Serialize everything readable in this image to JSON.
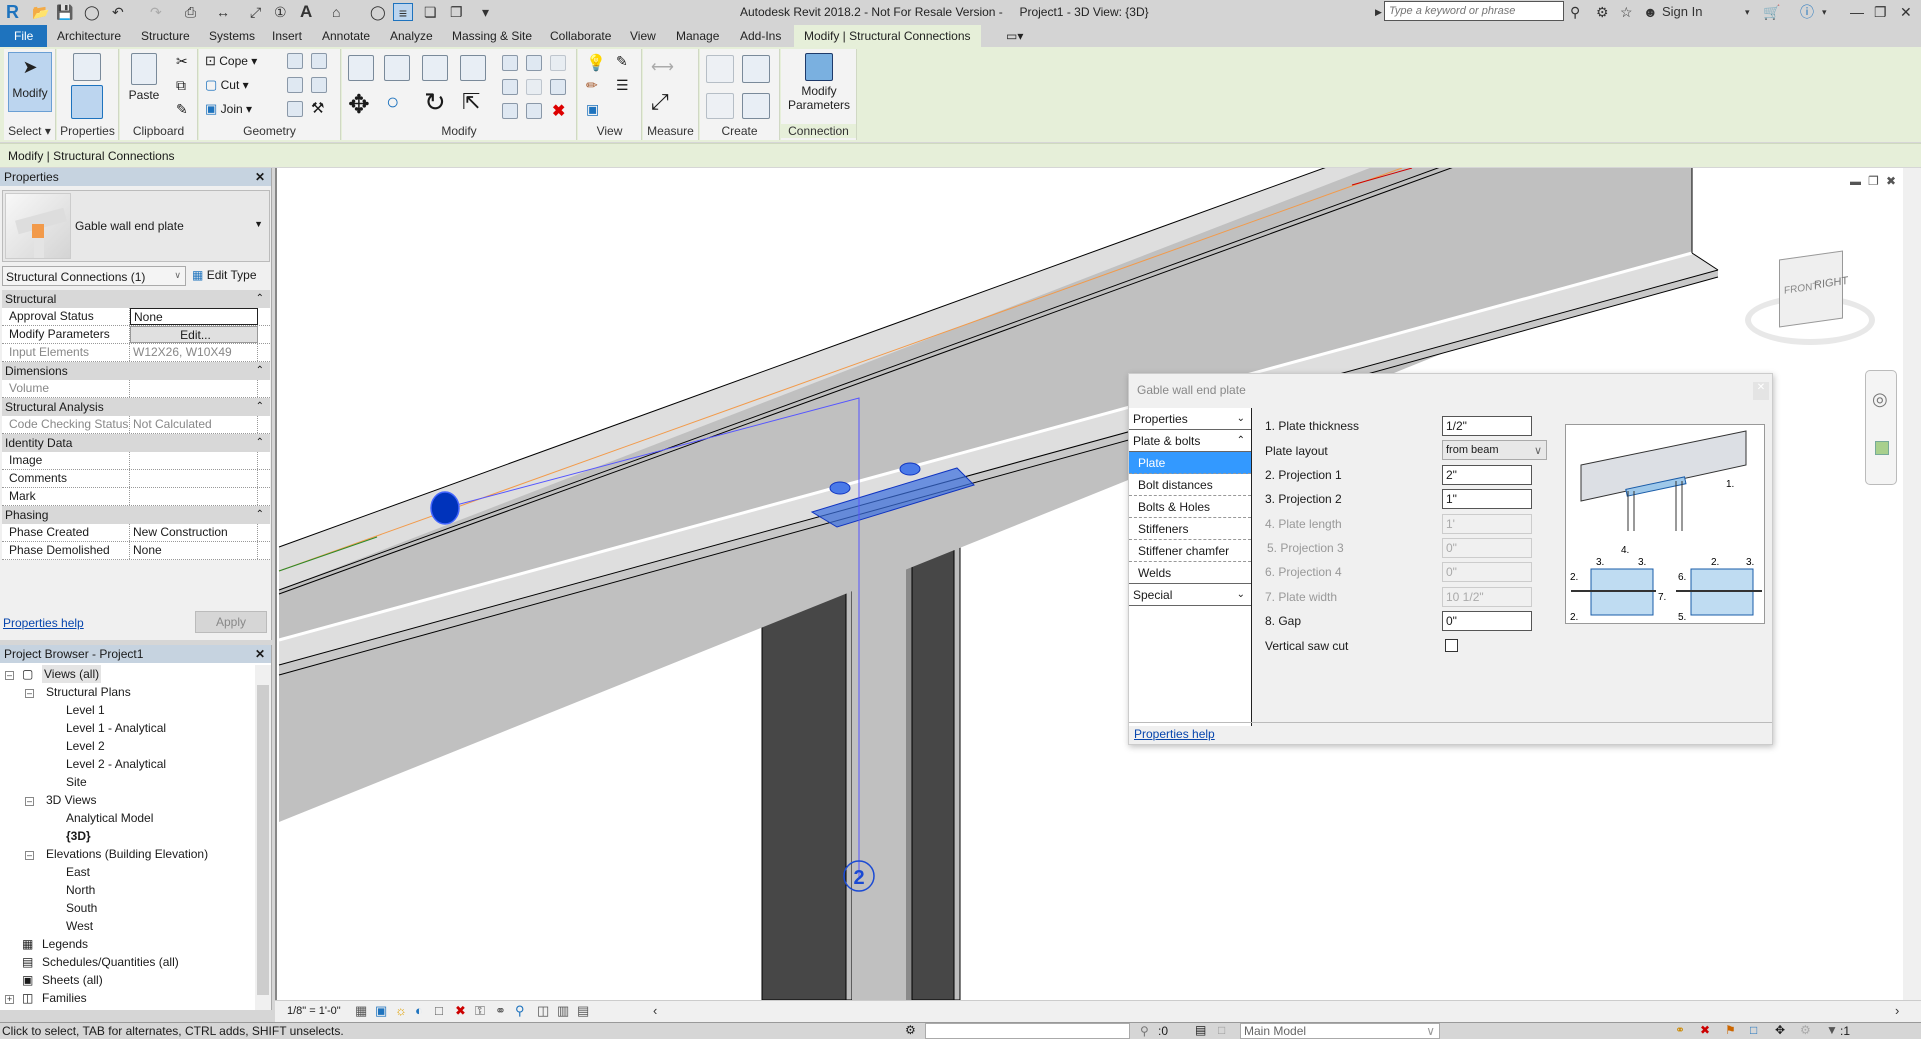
{
  "app": {
    "title": "Autodesk Revit 2018.2 - Not For Resale Version -     Project1 - 3D View: {3D}",
    "search_placeholder": "Type a keyword or phrase",
    "sign_in": "Sign In"
  },
  "tabs": [
    "File",
    "Architecture",
    "Structure",
    "Systems",
    "Insert",
    "Annotate",
    "Analyze",
    "Massing & Site",
    "Collaborate",
    "View",
    "Manage",
    "Add-Ins",
    "Modify | Structural Connections"
  ],
  "ribbon": {
    "panels": {
      "select": "Select",
      "properties": "Properties",
      "clipboard": "Clipboard",
      "geometry": "Geometry",
      "modify": "Modify",
      "view": "View",
      "measure": "Measure",
      "create": "Create",
      "connection": "Connection"
    },
    "modify_button": "Modify",
    "paste_button": "Paste",
    "cope": "Cope",
    "cut": "Cut",
    "join": "Join",
    "modify_parameters": "Modify Parameters"
  },
  "options_bar": "Modify | Structural Connections",
  "properties": {
    "title": "Properties",
    "type_name": "Gable wall end plate",
    "instance_selector": "Structural Connections (1)",
    "edit_type": "Edit Type",
    "groups": [
      {
        "name": "Structural",
        "rows": [
          {
            "key": "Approval Status",
            "value": "None"
          },
          {
            "key": "Modify Parameters",
            "value": "Edit..."
          },
          {
            "key": "Input Elements",
            "value": "W12X26, W10X49"
          }
        ]
      },
      {
        "name": "Dimensions",
        "rows": [
          {
            "key": "Volume",
            "value": ""
          }
        ]
      },
      {
        "name": "Structural Analysis",
        "rows": [
          {
            "key": "Code Checking Status",
            "value": "Not Calculated"
          }
        ]
      },
      {
        "name": "Identity Data",
        "rows": [
          {
            "key": "Image",
            "value": ""
          },
          {
            "key": "Comments",
            "value": ""
          },
          {
            "key": "Mark",
            "value": ""
          }
        ]
      },
      {
        "name": "Phasing",
        "rows": [
          {
            "key": "Phase Created",
            "value": "New Construction"
          },
          {
            "key": "Phase Demolished",
            "value": "None"
          }
        ]
      }
    ],
    "help": "Properties help",
    "apply": "Apply"
  },
  "project_browser": {
    "title": "Project Browser - Project1",
    "items": [
      "Views (all)",
      "Structural Plans",
      "Level 1",
      "Level 1 - Analytical",
      "Level 2",
      "Level 2 - Analytical",
      "Site",
      "3D Views",
      "Analytical Model",
      "{3D}",
      "Elevations (Building Elevation)",
      "East",
      "North",
      "South",
      "West",
      "Legends",
      "Schedules/Quantities (all)",
      "Sheets (all)",
      "Families"
    ]
  },
  "viewport": {
    "scale": "1/8\" = 1'-0\"",
    "grid_label": "2",
    "navcube_front": "FRONT",
    "navcube_right": "RIGHT"
  },
  "dialog": {
    "title": "Gable wall end plate",
    "nav": [
      {
        "label": "Properties",
        "type": "group",
        "state": "collapsed"
      },
      {
        "label": "Plate & bolts",
        "type": "group",
        "state": "expanded"
      },
      {
        "label": "Plate",
        "type": "item",
        "selected": true
      },
      {
        "label": "Bolt distances",
        "type": "item"
      },
      {
        "label": "Bolts & Holes",
        "type": "item"
      },
      {
        "label": "Stiffeners",
        "type": "item"
      },
      {
        "label": "Stiffener chamfer",
        "type": "item"
      },
      {
        "label": "Welds",
        "type": "item"
      },
      {
        "label": "Special",
        "type": "group",
        "state": "collapsed"
      }
    ],
    "fields": [
      {
        "label": "1. Plate thickness",
        "value": "1/2\"",
        "enabled": true
      },
      {
        "label": "Plate layout",
        "value": "from beam",
        "enabled": true,
        "type": "select"
      },
      {
        "label": "2. Projection 1",
        "value": "2\"",
        "enabled": true
      },
      {
        "label": "3. Projection 2",
        "value": "1\"",
        "enabled": true
      },
      {
        "label": "4. Plate length",
        "value": "1'",
        "enabled": false
      },
      {
        "label": "5. Projection 3",
        "value": "0\"",
        "enabled": false
      },
      {
        "label": "6. Projection 4",
        "value": "0\"",
        "enabled": false
      },
      {
        "label": "7. Plate width",
        "value": "10 1/2\"",
        "enabled": false
      },
      {
        "label": "8. Gap",
        "value": "0\"",
        "enabled": true
      },
      {
        "label": "Vertical saw cut",
        "value": false,
        "enabled": true,
        "type": "checkbox"
      }
    ],
    "help": "Properties help"
  },
  "status": {
    "message": "Click to select, TAB for alternates, CTRL adds, SHIFT unselects.",
    "selection_count": ":0",
    "model": "Main Model",
    "filter_count": ":1"
  },
  "colors": {
    "accent": "#1e73be",
    "context_tab": "#e6efd9",
    "selection": "#3399ff",
    "element_highlight": "#0033cc"
  }
}
